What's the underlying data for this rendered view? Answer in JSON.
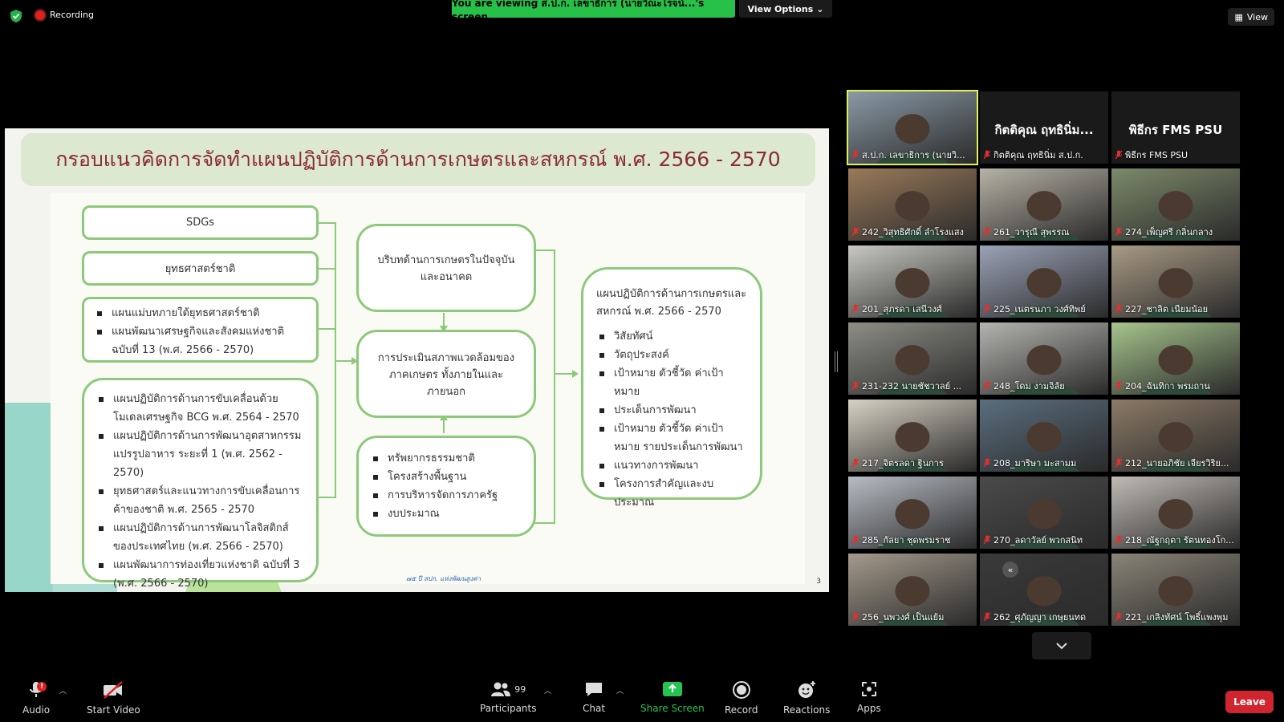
{
  "top": {
    "recording_label": "Recording",
    "viewing_banner": "You are viewing ส.ป.ก. เลขาธิการ (นายวิณะโรจน์...'s screen",
    "view_options_label": "View Options",
    "view_label": "View"
  },
  "slide": {
    "title": "กรอบแนวคิดการจัดทำแผนปฏิบัติการด้านการเกษตรและสหกรณ์ พ.ศ. 2566 - 2570",
    "box_sdgs": "SDGs",
    "box_national_strategy": "ยุทธศาสตร์ชาติ",
    "box_master_plans": [
      "แผนแม่บทภายใต้ยุทธศาสตร์ชาติ",
      "แผนพัฒนาเศรษฐกิจและสังคมแห่งชาติ ฉบับที่ 13 (พ.ศ. 2566 - 2570)"
    ],
    "box_plans": [
      "แผนปฏิบัติการด้านการขับเคลื่อนด้วยโมเดลเศรษฐกิจ BCG พ.ศ. 2564 - 2570",
      "แผนปฏิบัติการด้านการพัฒนาอุตสาหกรรมแปรรูปอาหาร ระยะที่ 1 (พ.ศ. 2562 - 2570)",
      "ยุทธศาสตร์และแนวทางการขับเคลื่อนการค้าของชาติ พ.ศ. 2565 - 2570",
      "แผนปฏิบัติการด้านการพัฒนาโลจิสติกส์ของประเทศไทย (พ.ศ. 2566 - 2570)",
      "แผนพัฒนาการท่องเที่ยวแห่งชาติ ฉบับที่ 3 (พ.ศ. 2566 - 2570)"
    ],
    "box_context": "บริบทด้านการเกษตรในปัจจุบันและอนาคต",
    "box_assessment": "การประเมินสภาพแวดล้อมของภาคเกษตร ทั้งภายในและภายนอก",
    "box_resources": [
      "ทรัพยากรธรรมชาติ",
      "โครงสร้างพื้นฐาน",
      "การบริหารจัดการภาครัฐ",
      "งบประมาณ"
    ],
    "box_result_title": "แผนปฏิบัติการด้านการเกษตรและสหกรณ์ พ.ศ. 2566 - 2570",
    "box_result_items": [
      "วิสัยทัศน์",
      "วัตถุประสงค์",
      "เป้าหมาย ตัวชี้วัด ค่าเป้าหมาย",
      "ประเด็นการพัฒนา",
      "เป้าหมาย ตัวชี้วัด ค่าเป้าหมาย รายประเด็นการพัฒนา",
      "แนวทางการพัฒนา",
      "โครงการสำคัญและงบประมาณ"
    ],
    "logo_text": "๗๕ ปี สปก. แห่งพัฒนสูงค่า",
    "page_number": "3"
  },
  "participants": [
    {
      "name": "ส.ป.ก. เลขาธิการ (นายวิ...",
      "video": true,
      "active": true,
      "tone": "#8a9aa6"
    },
    {
      "name": "กิตติคุณ ฤทธินิ่ม ส.ป.ก.",
      "display": "กิตติคุณ ฤทธินิ่ม...",
      "video": false
    },
    {
      "name": "พิธีกร FMS PSU",
      "display": "พิธีกร FMS PSU",
      "video": false
    },
    {
      "name": "242_วิสุทธิศักดิ์ ลำโรงแสง",
      "video": true,
      "tone": "#9a7a5a"
    },
    {
      "name": "261_วารุณี สุพรรณ",
      "video": true,
      "tone": "#b7b2a6"
    },
    {
      "name": "274_เพ็ญศรี กลิ่นกลาง",
      "video": true,
      "tone": "#7c8a6a"
    },
    {
      "name": "201_สุภรดา เสนีวงศ์",
      "video": true,
      "tone": "#c9c9c2"
    },
    {
      "name": "225_เนตรนภา วงศ์ทิพย์",
      "video": true,
      "tone": "#9aa2b6"
    },
    {
      "name": "227_ชาลิต เนียมน้อย",
      "video": true,
      "tone": "#a89a84"
    },
    {
      "name": "231-232 นายชัชวาลย์ ...",
      "video": true,
      "tone": "#8e8e86"
    },
    {
      "name": "248_โดม งามจิลัย",
      "video": true,
      "tone": "#b4b4b0"
    },
    {
      "name": "204_ฉันทิกา พรมถาน",
      "video": true,
      "tone": "#a6c48c"
    },
    {
      "name": "217_จิตรลดา ฐินการ",
      "video": true,
      "tone": "#d8d2c4"
    },
    {
      "name": "208_มาริษา มะสามม",
      "video": true,
      "tone": "#5a6e7e"
    },
    {
      "name": "212_นายอภิชัย เจียรวิริย...",
      "video": true,
      "tone": "#8c7a66"
    },
    {
      "name": "285_กัลยา ชุดพรมราช",
      "video": true,
      "tone": "#b8bcc4"
    },
    {
      "name": "270_ลดาวัลย์ พวกสนิท",
      "video": true,
      "tone": "#4a4a4a"
    },
    {
      "name": "218_ณัฐกฤตา รัตนทองโก...",
      "video": true,
      "tone": "#c0bab4"
    },
    {
      "name": "256_นพวงศ์ เป็นแย้ม",
      "video": true,
      "tone": "#a49a8c"
    },
    {
      "name": "262_ศุภัญญา เกษุยนทด",
      "video": true,
      "tone": "#3a3a3a"
    },
    {
      "name": "221_เกลิงทัศน์ โพธิ์แพงพุม",
      "video": true,
      "tone": "#8a8478"
    }
  ],
  "toolbar": {
    "audio": "Audio",
    "start_video": "Start Video",
    "participants": "Participants",
    "participants_count": "99",
    "chat": "Chat",
    "share_screen": "Share Screen",
    "record": "Record",
    "reactions": "Reactions",
    "apps": "Apps",
    "leave": "Leave",
    "audio_badge": "!"
  },
  "colors": {
    "viewing_banner": "#27c14a",
    "share_screen": "#23c552",
    "leave": "#d0252e",
    "active_speaker": "#e3ef57",
    "slide_title_text": "#8b2a3a",
    "slide_box_border": "#8cc97a"
  }
}
